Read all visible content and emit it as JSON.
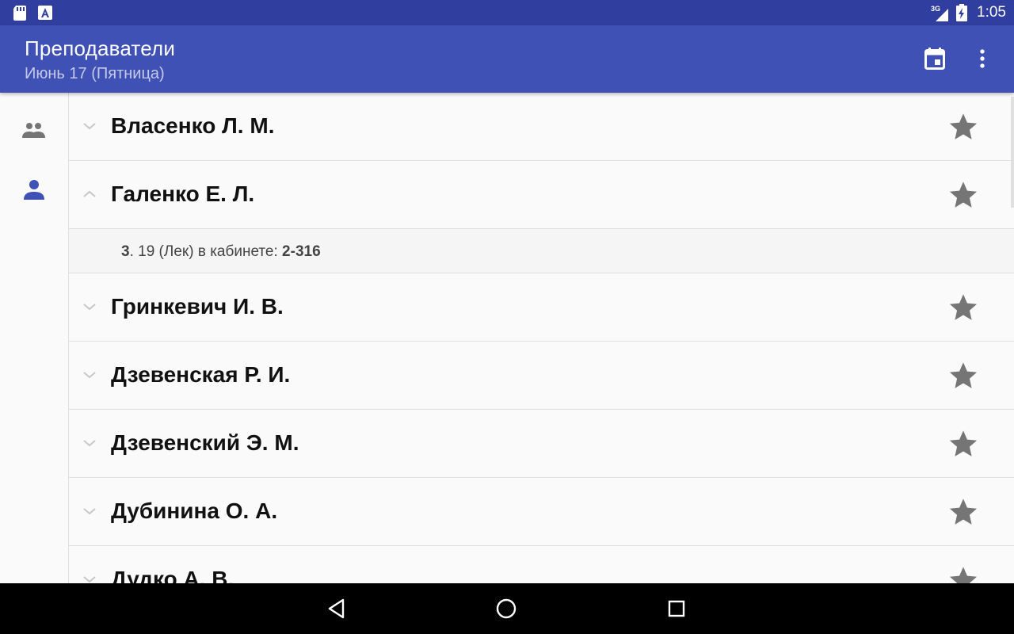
{
  "status_bar": {
    "time": "1:05",
    "network": "3G",
    "icons": [
      "sd-card-icon",
      "notification-a-icon",
      "signal-icon",
      "battery-charging-icon"
    ]
  },
  "app_bar": {
    "title": "Преподаватели",
    "subtitle": "Июнь 17 (Пятница)",
    "actions": [
      "calendar-icon",
      "more-vert-icon"
    ]
  },
  "rail": {
    "items": [
      {
        "icon": "group-icon",
        "selected": false
      },
      {
        "icon": "person-icon",
        "selected": true
      }
    ]
  },
  "teachers": [
    {
      "name": "Власенко Л. М.",
      "expanded": false
    },
    {
      "name": "Галенко Е. Л.",
      "expanded": true,
      "detail": {
        "number": "3",
        "text": ". 19 (Лек) в кабинете: ",
        "room": "2-316"
      }
    },
    {
      "name": "Гринкевич И. В.",
      "expanded": false
    },
    {
      "name": "Дзевенская Р. И.",
      "expanded": false
    },
    {
      "name": "Дзевенский Э. М.",
      "expanded": false
    },
    {
      "name": "Дубинина О. А.",
      "expanded": false
    },
    {
      "name": "Дудко А. В.",
      "expanded": false
    }
  ],
  "colors": {
    "status_bar": "#303f9f",
    "app_bar": "#3f51b5",
    "accent": "#3f51b5",
    "star": "#757575"
  }
}
